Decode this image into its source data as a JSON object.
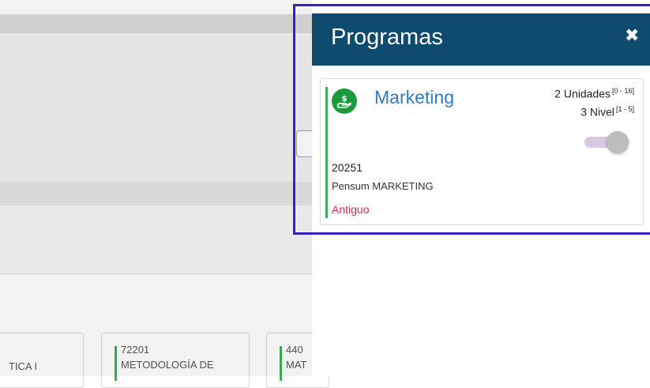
{
  "drawer": {
    "title": "Programas",
    "close_symbol": "✖"
  },
  "program": {
    "icon": "money-hand-icon",
    "name": "Marketing",
    "units": "2 Unidades",
    "units_range": "[0 - 16]",
    "level": "3 Nivel",
    "level_range": "[1 - 5]",
    "code": "20251",
    "pensum": "Pensum MARKETING",
    "status": "Antiguo",
    "toggle_on": false
  },
  "background": {
    "courses": [
      {
        "code": "",
        "name": "TICA I"
      },
      {
        "code": "72201",
        "name": "METODOLOGÍA DE"
      },
      {
        "code": "440",
        "name": "MAT"
      }
    ]
  },
  "colors": {
    "header": "#0e4b6e",
    "accent_green": "#3cb050",
    "link_blue": "#2e7bbf",
    "status_red": "#e0244a",
    "highlight": "#3b1ec4"
  }
}
